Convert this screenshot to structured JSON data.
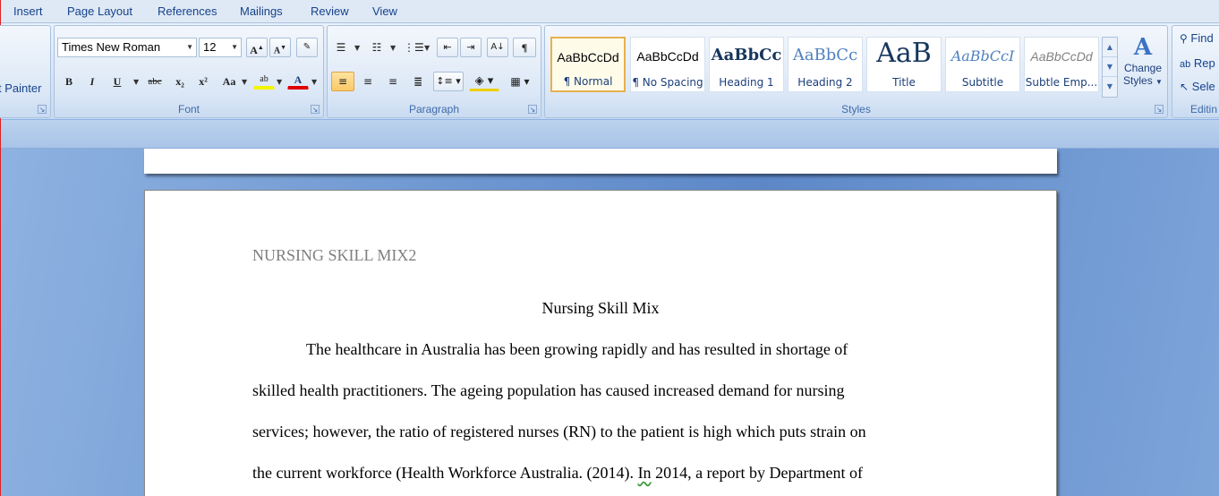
{
  "menu_tabs": [
    "Insert",
    "Page Layout",
    "References",
    "Mailings",
    "Review",
    "View"
  ],
  "clipboard": {
    "format_painter_label": "t Painter"
  },
  "font_group": {
    "label": "Font",
    "font_name": "Times New Roman",
    "font_size": "12",
    "bold": "B",
    "italic": "I",
    "underline": "U",
    "strike": "abc",
    "subscript": "x₂",
    "superscript": "x²",
    "change_case": "Aa",
    "highlight": "ab",
    "font_color": "A",
    "grow": "A",
    "shrink": "A"
  },
  "paragraph_group": {
    "label": "Paragraph",
    "show_marks": "¶"
  },
  "styles_group": {
    "label": "Styles",
    "styles": [
      {
        "sample": "AaBbCcDd",
        "name": "¶ Normal",
        "selected": true
      },
      {
        "sample": "AaBbCcDd",
        "name": "¶ No Spacing",
        "selected": false
      },
      {
        "sample": "AaBbCc",
        "name": "Heading 1",
        "selected": false
      },
      {
        "sample": "AaBbCc",
        "name": "Heading 2",
        "selected": false
      },
      {
        "sample": "AaB",
        "name": "Title",
        "selected": false
      },
      {
        "sample": "AaBbCcI",
        "name": "Subtitle",
        "selected": false
      },
      {
        "sample": "AaBbCcDd",
        "name": "Subtle Emp...",
        "selected": false
      }
    ],
    "change_styles_line1": "Change",
    "change_styles_line2": "Styles"
  },
  "editing_group": {
    "label": "Editin",
    "find": "Find",
    "replace": "Rep",
    "select": "Sele"
  },
  "document": {
    "header": "NURSING SKILL MIX2",
    "title": "Nursing Skill Mix",
    "lines": [
      "The healthcare in Australia has been growing rapidly and has resulted in shortage of",
      "skilled health practitioners.  The ageing population has caused increased demand  for nursing",
      "services; however, the ratio of registered nurses (RN) to the patient is high which puts strain on",
      "the current workforce (Health Workforce Australia. (2014)."
    ],
    "line4_flag_word": "In",
    "line4_tail": " 2014, a report by Department of"
  }
}
